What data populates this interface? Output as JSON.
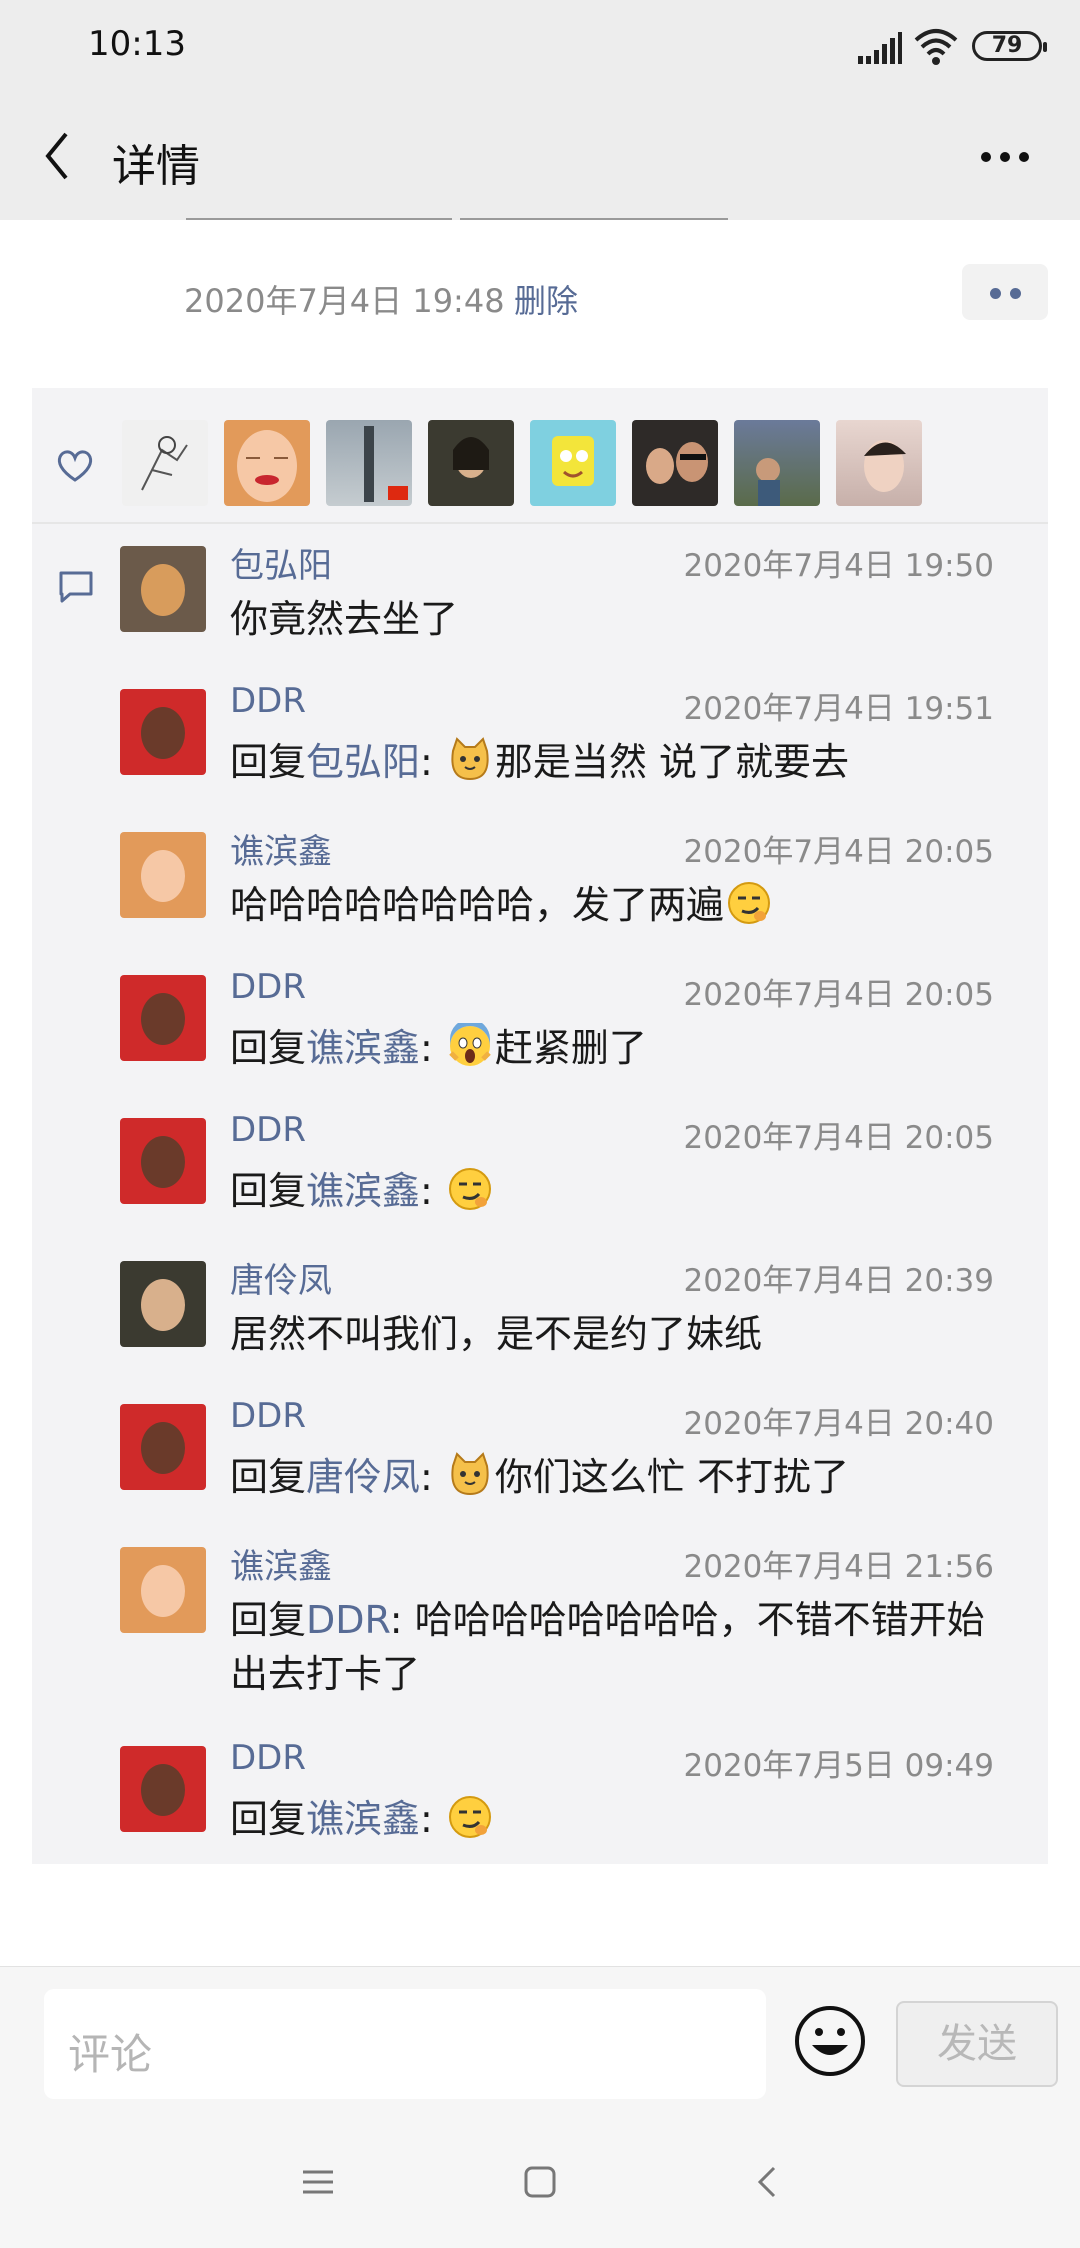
{
  "status_bar": {
    "time": "10:13",
    "battery": "79"
  },
  "header": {
    "title": "详情",
    "back_icon": "chevron-left-icon",
    "more_icon": "more-horizontal-icon"
  },
  "post": {
    "timestamp": "2020年7月4日 19:48",
    "delete_label": "删除"
  },
  "likes": [
    "avatar-1",
    "avatar-2",
    "avatar-3",
    "avatar-4",
    "avatar-5",
    "avatar-6",
    "avatar-7",
    "avatar-8"
  ],
  "comments": [
    {
      "name": "包弘阳",
      "time": "2020年7月4日 19:50",
      "text": "你竟然去坐了"
    },
    {
      "name": "DDR",
      "time": "2020年7月4日 19:51",
      "reply_prefix": "回复",
      "reply_to": "包弘阳",
      "sep": ": ",
      "text": "那是当然  说了就要去",
      "emoji": "cat-face"
    },
    {
      "name": "谯滨鑫",
      "time": "2020年7月4日 20:05",
      "text": "哈哈哈哈哈哈哈哈，发了两遍",
      "emoji": "smirk-face"
    },
    {
      "name": "DDR",
      "time": "2020年7月4日 20:05",
      "reply_prefix": "回复",
      "reply_to": "谯滨鑫",
      "sep": ": ",
      "text": "赶紧删了",
      "emoji": "scream-face"
    },
    {
      "name": "DDR",
      "time": "2020年7月4日 20:05",
      "reply_prefix": "回复",
      "reply_to": "谯滨鑫",
      "sep": ": ",
      "text": "",
      "emoji": "smirk-face"
    },
    {
      "name": "唐伶凤",
      "time": "2020年7月4日 20:39",
      "text": "居然不叫我们，是不是约了妹纸"
    },
    {
      "name": "DDR",
      "time": "2020年7月4日 20:40",
      "reply_prefix": "回复",
      "reply_to": "唐伶凤",
      "sep": ": ",
      "text": "你们这么忙 不打扰了",
      "emoji": "cat-face"
    },
    {
      "name": "谯滨鑫",
      "time": "2020年7月4日 21:56",
      "reply_prefix": "回复",
      "reply_to": "DDR",
      "sep": ": ",
      "text": "哈哈哈哈哈哈哈哈，不错不错开始出去打卡了"
    },
    {
      "name": "DDR",
      "time": "2020年7月5日 09:49",
      "reply_prefix": "回复",
      "reply_to": "谯滨鑫",
      "sep": ": ",
      "text": "",
      "emoji": "smirk-face"
    }
  ],
  "composer": {
    "placeholder": "评论",
    "send_label": "发送",
    "emoji_icon": "smiley-icon"
  },
  "colors": {
    "link": "#576b95",
    "background": "#ededed",
    "panel": "#f3f3f5"
  }
}
